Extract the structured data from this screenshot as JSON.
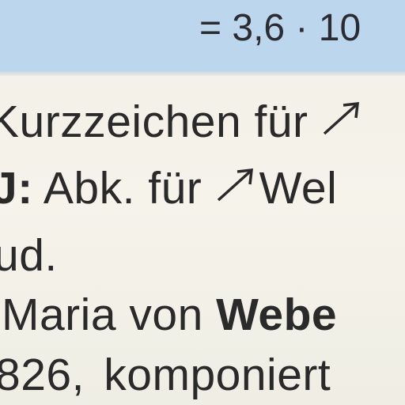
{
  "formula_band": {
    "text": "= 3,6 · 10",
    "background": "#bcd6ee"
  },
  "lines": {
    "line1": "Kurzzeichen für ",
    "line2_bold": "J:",
    "line2_rest": " Abk. für ",
    "line2_after_arrow": "Wel",
    "line3": "ud.",
    "line4_plain": "Maria von ",
    "line4_bold": "Webe",
    "line5": "826, komponiert"
  },
  "icons": {
    "cross_reference_arrow": "northeast-arrow-icon"
  },
  "colors": {
    "paper": "#f3f1e8",
    "ink": "#2a2a2a",
    "highlight": "#bcd6ee"
  }
}
